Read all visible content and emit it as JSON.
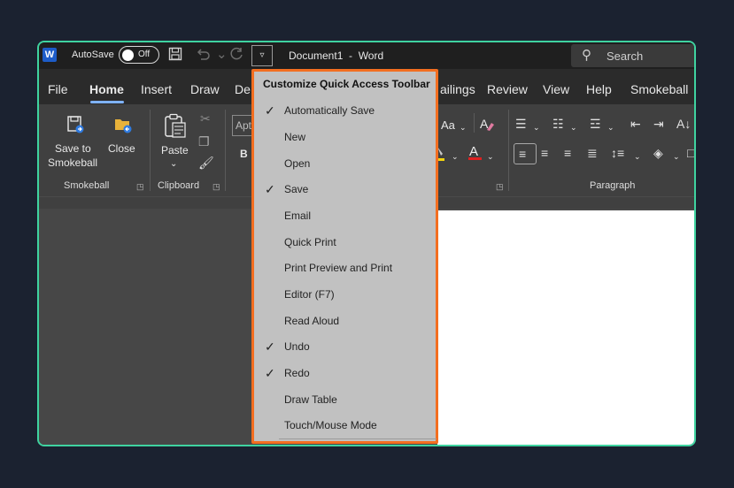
{
  "titlebar": {
    "autosave_label": "AutoSave",
    "autosave_state": "Off",
    "document_title": "Document1  -  Word",
    "search_placeholder": "Search"
  },
  "tabs": [
    "File",
    "Home",
    "Insert",
    "Draw",
    "De",
    "ailings",
    "Review",
    "View",
    "Help",
    "Smokeball"
  ],
  "active_tab": "Home",
  "ribbon": {
    "smokeball_group": {
      "save_label_1": "Save to",
      "save_label_2": "Smokeball",
      "close_label": "Close",
      "group_label": "Smokeball"
    },
    "clipboard_group": {
      "paste_label": "Paste",
      "group_label": "Clipboard"
    },
    "font_group": {
      "font_name_fragment": "Apt",
      "bold": "B",
      "change_case": "Aa"
    },
    "paragraph_group": {
      "group_label": "Paragraph"
    }
  },
  "qat_menu": {
    "title": "Customize Quick Access Toolbar",
    "items": [
      {
        "label": "Automatically Save",
        "checked": "✓"
      },
      {
        "label": "New",
        "checked": ""
      },
      {
        "label": "Open",
        "checked": ""
      },
      {
        "label": "Save",
        "checked": "✓"
      },
      {
        "label": "Email",
        "checked": ""
      },
      {
        "label": "Quick Print",
        "checked": ""
      },
      {
        "label": "Print Preview and Print",
        "checked": ""
      },
      {
        "label": "Editor (F7)",
        "checked": ""
      },
      {
        "label": "Read Aloud",
        "checked": ""
      },
      {
        "label": "Undo",
        "checked": "✓"
      },
      {
        "label": "Redo",
        "checked": "✓"
      },
      {
        "label": "Draw Table",
        "checked": ""
      },
      {
        "label": "Touch/Mouse Mode",
        "checked": ""
      }
    ]
  },
  "colors": {
    "menu_border": "#f36e20",
    "frame_border": "#3fd3a0",
    "active_tab_underline": "#7fb2ff",
    "font_color_bar": "#e02020",
    "highlight_bar": "#f2d40f"
  }
}
